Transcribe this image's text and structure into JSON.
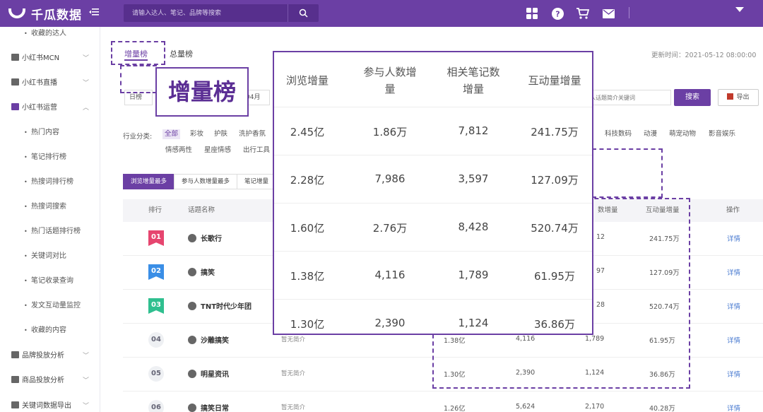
{
  "header": {
    "app_name": "千瓜数据",
    "search_placeholder": "请输入达人、笔记、品牌等搜索"
  },
  "sidebar": {
    "items": [
      {
        "label": "收藏的达人",
        "type": "sub"
      },
      {
        "label": "小红书MCN",
        "type": "group"
      },
      {
        "label": "小红书直播",
        "type": "group"
      },
      {
        "label": "小红书运营",
        "type": "group",
        "expanded": true
      },
      {
        "label": "热门内容",
        "type": "sub"
      },
      {
        "label": "笔记排行榜",
        "type": "sub"
      },
      {
        "label": "热搜词排行榜",
        "type": "sub"
      },
      {
        "label": "热搜词搜索",
        "type": "sub"
      },
      {
        "label": "热门话题排行榜",
        "type": "sub"
      },
      {
        "label": "关键词对比",
        "type": "sub"
      },
      {
        "label": "笔记收录查询",
        "type": "sub"
      },
      {
        "label": "发文互动量监控",
        "type": "sub"
      },
      {
        "label": "收藏的内容",
        "type": "sub"
      },
      {
        "label": "品牌投放分析",
        "type": "group"
      },
      {
        "label": "商品投放分析",
        "type": "group"
      },
      {
        "label": "关键词数据导出",
        "type": "group"
      }
    ]
  },
  "tabs": {
    "active": "增量榜",
    "other": "总量榜"
  },
  "update_time": "更新时间：2021-05-12 08:00:00",
  "filters": {
    "period": "日榜",
    "date_fragment": "04月",
    "keyword_placeholder": "请输入话题简介关键词",
    "search_label": "搜索",
    "export_label": "导出"
  },
  "categories": {
    "label": "行业分类:",
    "row1": [
      "全部",
      "彩妆",
      "护肤",
      "洗护香氛"
    ],
    "row1_right": [
      "科技数码",
      "动漫",
      "萌宠动物",
      "影音娱乐"
    ],
    "row2": [
      "情感两性",
      "星座情感",
      "出行工具"
    ]
  },
  "sort_buttons": [
    "浏览增量最多",
    "参与人数增量最多",
    "笔记增量"
  ],
  "table": {
    "headers": {
      "rank": "排行",
      "name": "话题名称",
      "notes_inc_partial": "数增量",
      "interact": "互动量增量",
      "action": "操作"
    },
    "rows": [
      {
        "rank": "01",
        "name": "长歌行",
        "desc": "",
        "views": "",
        "participants": "",
        "notes": "12",
        "interact": "241.75万"
      },
      {
        "rank": "02",
        "name": "搞笑",
        "desc": "",
        "views": "",
        "participants": "",
        "notes": "97",
        "interact": "127.09万"
      },
      {
        "rank": "03",
        "name": "TNT时代少年团",
        "desc": "",
        "views": "",
        "participants": "",
        "notes": "28",
        "interact": "520.74万"
      },
      {
        "rank": "04",
        "name": "沙雕搞笑",
        "desc": "暂无简介",
        "views": "1.38亿",
        "participants": "4,116",
        "notes": "1,789",
        "interact": "61.95万"
      },
      {
        "rank": "05",
        "name": "明星资讯",
        "desc": "暂无简介",
        "views": "1.30亿",
        "participants": "2,390",
        "notes": "1,124",
        "interact": "36.86万"
      },
      {
        "rank": "06",
        "name": "搞笑日常",
        "desc": "暂无简介",
        "views": "1.26亿",
        "participants": "5,624",
        "notes": "2,170",
        "interact": "40.28万"
      }
    ],
    "detail_label": "详情"
  },
  "callout": "增量榜",
  "zoom": {
    "headers": [
      "浏览增量",
      "参与人数增量",
      "相关笔记数增量",
      "互动量增量"
    ],
    "rows": [
      [
        "2.45亿",
        "1.86万",
        "7,812",
        "241.75万"
      ],
      [
        "2.28亿",
        "7,986",
        "3,597",
        "127.09万"
      ],
      [
        "1.60亿",
        "2.76万",
        "8,428",
        "520.74万"
      ],
      [
        "1.38亿",
        "4,116",
        "1,789",
        "61.95万"
      ],
      [
        "1.30亿",
        "2,390",
        "1,124",
        "36.86万"
      ]
    ]
  },
  "colors": {
    "brand": "#6b3fa4",
    "rank1": "#e6456f",
    "rank2": "#3a8ee6",
    "rank3": "#2fbf8f"
  }
}
